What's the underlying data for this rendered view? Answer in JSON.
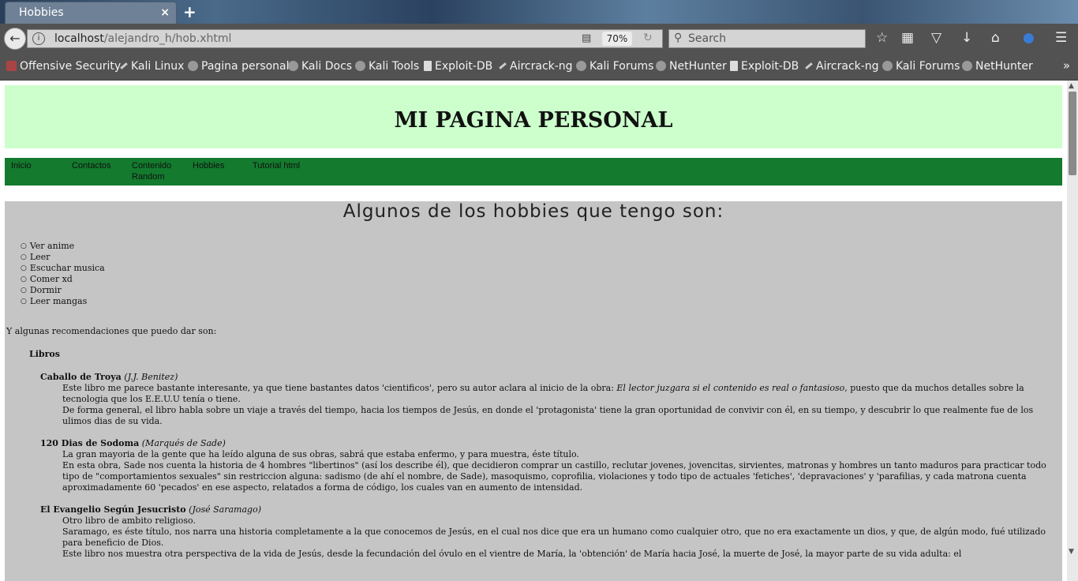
{
  "browser": {
    "tab_title": "Hobbies",
    "tab_close": "×",
    "new_tab": "+",
    "url_host": "localhost",
    "url_path": "/alejandro_h/hob.xhtml",
    "zoom": "70%",
    "search_placeholder": "Search",
    "bookmarks": [
      "Offensive Security",
      "Kali Linux",
      "Pagina personal",
      "Kali Docs",
      "Kali Tools",
      "Exploit-DB",
      "Aircrack-ng",
      "Kali Forums",
      "NetHunter",
      "Exploit-DB",
      "Aircrack-ng",
      "Kali Forums",
      "NetHunter"
    ],
    "bookmarks_more": "»"
  },
  "page": {
    "header_title": "MI PAGINA PERSONAL",
    "menu": [
      "Inicio",
      "Contactos",
      "Contenido Random",
      "Hobbies",
      "Tutorial html"
    ],
    "section_title": "Algunos de los hobbies que tengo son:",
    "hobbies": [
      "Ver anime",
      "Leer",
      "Escuchar musica",
      "Comer xd",
      "Dormir",
      "Leer mangas"
    ],
    "recommend_intro": "Y algunas recomendaciones que puedo dar son:",
    "category": "Libros",
    "books": [
      {
        "title": "Caballo de Troya",
        "author": "(J.J. Benitez)",
        "d1a": "Este libro me parece bastante interesante, ya que tiene bastantes datos 'cientificos', pero su autor aclara al inicio de la obra: ",
        "d1i": "El lector juzgara si el contenido es real o fantasioso",
        "d1b": ", puesto que da muchos detalles sobre la tecnologia que los E.E.U.U tenía o tiene.",
        "d2": "De forma general, el libro habla sobre un viaje a través del tiempo, hacia los tiempos de Jesús, en donde el 'protagonista' tiene la gran oportunidad de convivir con él, en su tiempo, y descubrir lo que realmente fue de los ulimos dias de su vida."
      },
      {
        "title": "120 Dias de Sodoma",
        "author": "(Marqués de Sade)",
        "d1": "La gran mayoria de la gente que ha leído alguna de sus obras, sabrá que estaba enfermo, y para muestra, éste título.",
        "d2": "En esta obra, Sade nos cuenta la historia de 4 hombres \"libertinos\" (así los describe él), que decidieron comprar un castillo, reclutar jovenes, jovencitas, sirvientes, matronas y hombres un tanto maduros para practicar todo tipo de \"comportamientos sexuales\" sin restriccion alguna: sadismo (de ahí el nombre, de Sade), masoquismo, coprofilia, violaciones y todo tipo de actuales 'fetiches', 'depravaciones' y 'parafilias, y cada matrona cuenta aproximadamente 60 'pecados' en ese aspecto, relatados a forma de código, los cuales van en aumento de intensidad."
      },
      {
        "title": "El Evangelio Según Jesucristo",
        "author": "(José Saramago)",
        "d1": "Otro libro de ambito religioso.",
        "d2": "Saramago, es éste título, nos narra una historia completamente a la que conocemos de Jesús, en el cual nos dice que era un humano como cualquier otro, que no era exactamente un dios, y que, de algún modo, fué utilizado para beneficio de Dios.",
        "d3": "Este libro nos muestra otra perspectiva de la vida de Jesús, desde la fecundación del óvulo en el vientre de María, la 'obtención' de María hacia José, la muerte de José, la mayor parte de su vida adulta: el"
      }
    ]
  }
}
